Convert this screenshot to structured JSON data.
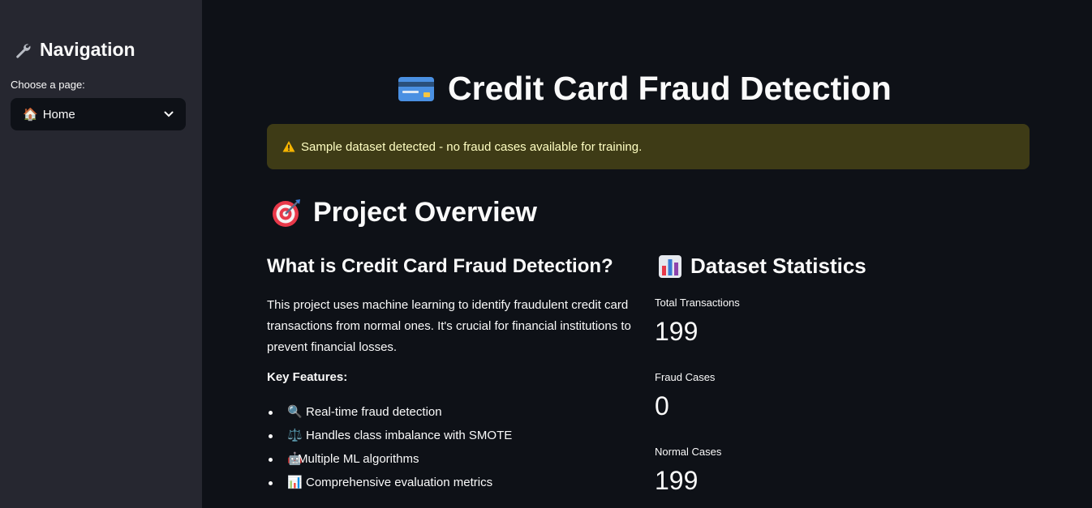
{
  "sidebar": {
    "title": "Navigation",
    "choose_label": "Choose a page:",
    "selected_page": "Home",
    "icon": "wrench-icon"
  },
  "header": {
    "title": "Credit Card Fraud Detection",
    "icon": "credit-card-icon"
  },
  "warning": {
    "text": "Sample dataset detected - no fraud cases available for training.",
    "color": "#3e3b16"
  },
  "overview": {
    "title": "Project Overview",
    "what_title": "What is Credit Card Fraud Detection?",
    "description": "This project uses machine learning to identify fraudulent credit card transactions from normal ones. It's crucial for financial institutions to prevent financial losses.",
    "key_features_label": "Key Features:",
    "features": [
      {
        "icon": "magnifier-icon",
        "text": "Real-time fraud detection"
      },
      {
        "icon": "scales-icon",
        "text": "Handles class imbalance with SMOTE"
      },
      {
        "icon": "robot-icon",
        "text": "Multiple ML algorithms"
      },
      {
        "icon": "bar-chart-icon",
        "text": "Comprehensive evaluation metrics"
      }
    ]
  },
  "stats": {
    "title": "Dataset Statistics",
    "metrics": [
      {
        "label": "Total Transactions",
        "value": "199"
      },
      {
        "label": "Fraud Cases",
        "value": "0"
      },
      {
        "label": "Normal Cases",
        "value": "199"
      }
    ]
  },
  "colors": {
    "background": "#0e1117",
    "sidebar": "#262730",
    "warning_text": "#ffffc2"
  }
}
